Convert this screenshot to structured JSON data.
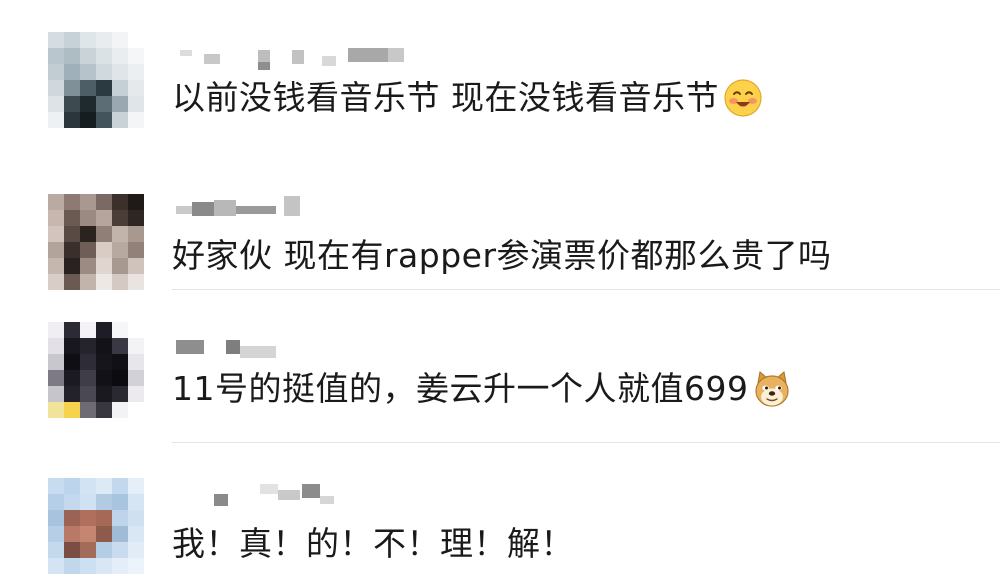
{
  "comments": [
    {
      "text": "以前没钱看音乐节 现在没钱看音乐节",
      "emoji": "blushing-smile-emoji"
    },
    {
      "text": "好家伙 现在有rapper参演票价都那么贵了吗",
      "emoji": null
    },
    {
      "text": "11号的挺值的，姜云升一个人就值699",
      "emoji": "doge-emoji"
    },
    {
      "text": "我！真！的！不！理！解！",
      "emoji": null
    }
  ]
}
